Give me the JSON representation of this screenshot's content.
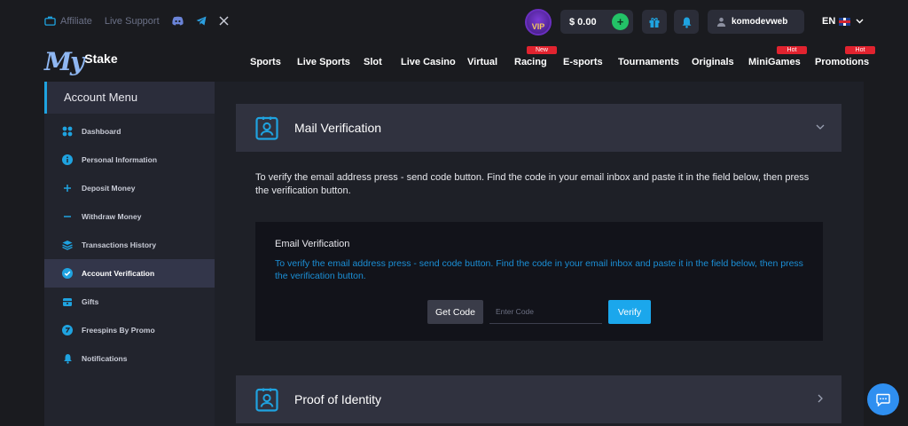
{
  "topbar": {
    "affiliate": "Affiliate",
    "live_support": "Live Support",
    "social": [
      "discord-icon",
      "telegram-icon",
      "x-icon"
    ],
    "vip": "VIP",
    "balance": "$ 0.00",
    "username": "komodevweb",
    "language": "EN"
  },
  "logo": {
    "my": "My",
    "stake": "Stake"
  },
  "nav": [
    {
      "label": "Sports",
      "tag": ""
    },
    {
      "label": "Live Sports",
      "tag": ""
    },
    {
      "label": "Slot",
      "tag": ""
    },
    {
      "label": "Live Casino",
      "tag": ""
    },
    {
      "label": "Virtual",
      "tag": ""
    },
    {
      "label": "Racing",
      "tag": "New"
    },
    {
      "label": "E-sports",
      "tag": ""
    },
    {
      "label": "Tournaments",
      "tag": ""
    },
    {
      "label": "Originals",
      "tag": ""
    },
    {
      "label": "MiniGames",
      "tag": "Hot"
    },
    {
      "label": "Promotions",
      "tag": "Hot"
    }
  ],
  "sidebar": {
    "title": "Account Menu",
    "items": [
      {
        "label": "Dashboard",
        "icon": "dashboard-icon"
      },
      {
        "label": "Personal Information",
        "icon": "info-icon"
      },
      {
        "label": "Deposit Money",
        "icon": "plus-icon"
      },
      {
        "label": "Withdraw Money",
        "icon": "minus-icon"
      },
      {
        "label": "Transactions History",
        "icon": "layers-icon"
      },
      {
        "label": "Account Verification",
        "icon": "verified-icon",
        "active": true
      },
      {
        "label": "Gifts",
        "icon": "gift-icon"
      },
      {
        "label": "Freespins By Promo",
        "icon": "freespins-icon"
      },
      {
        "label": "Notifications",
        "icon": "bell-icon"
      }
    ]
  },
  "main": {
    "mail_section_title": "Mail Verification",
    "description": "To verify the email address press - send code button. Find the code in your email inbox and paste it in the field below, then press the verification button.",
    "box_title": "Email Verification",
    "box_description": "To verify the email address press - send code button. Find the code in your email inbox and paste it in the field below, then press the verification button.",
    "get_code_label": "Get Code",
    "code_placeholder": "Enter Code",
    "verify_label": "Verify",
    "identity_section_title": "Proof of Identity"
  },
  "colors": {
    "accent": "#1ba7ec",
    "tag_red": "#e1232f",
    "green": "#23c267"
  }
}
